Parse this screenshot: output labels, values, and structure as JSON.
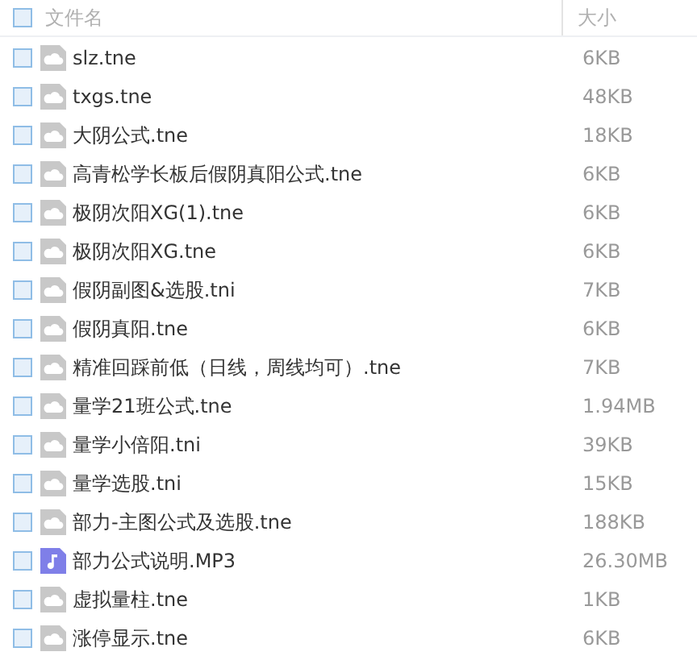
{
  "header": {
    "checked": false,
    "name_label": "文件名",
    "size_label": "大小"
  },
  "files": [
    {
      "name": "slz.tne",
      "size": "6KB",
      "kind": "file",
      "checked": false
    },
    {
      "name": "txgs.tne",
      "size": "48KB",
      "kind": "file",
      "checked": false
    },
    {
      "name": "大阴公式.tne",
      "size": "18KB",
      "kind": "file",
      "checked": false
    },
    {
      "name": "高青松学长板后假阴真阳公式.tne",
      "size": "6KB",
      "kind": "file",
      "checked": false
    },
    {
      "name": "极阴次阳XG(1).tne",
      "size": "6KB",
      "kind": "file",
      "checked": false
    },
    {
      "name": "极阴次阳XG.tne",
      "size": "6KB",
      "kind": "file",
      "checked": false
    },
    {
      "name": "假阴副图&选股.tni",
      "size": "7KB",
      "kind": "file",
      "checked": false
    },
    {
      "name": "假阴真阳.tne",
      "size": "6KB",
      "kind": "file",
      "checked": false
    },
    {
      "name": "精准回踩前低（日线，周线均可）.tne",
      "size": "7KB",
      "kind": "file",
      "checked": false
    },
    {
      "name": "量学21班公式.tne",
      "size": "1.94MB",
      "kind": "file",
      "checked": false
    },
    {
      "name": "量学小倍阳.tni",
      "size": "39KB",
      "kind": "file",
      "checked": false
    },
    {
      "name": "量学选股.tni",
      "size": "15KB",
      "kind": "file",
      "checked": false
    },
    {
      "name": "部力-主图公式及选股.tne",
      "size": "188KB",
      "kind": "file",
      "checked": false
    },
    {
      "name": "部力公式说明.MP3",
      "size": "26.30MB",
      "kind": "audio",
      "checked": false
    },
    {
      "name": "虚拟量柱.tne",
      "size": "1KB",
      "kind": "file",
      "checked": false
    },
    {
      "name": "涨停显示.tne",
      "size": "6KB",
      "kind": "file",
      "checked": false
    }
  ]
}
